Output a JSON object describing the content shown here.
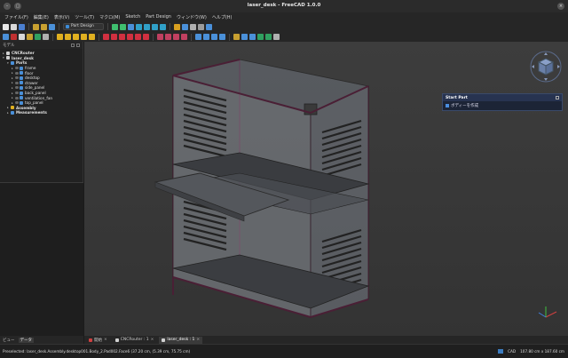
{
  "window": {
    "title": "laser_desk - FreeCAD 1.0.0",
    "minimize_label": "–",
    "maximize_label": "▢",
    "close_label": "×"
  },
  "menu": [
    "ファイル(F)",
    "編集(E)",
    "表示(V)",
    "ツール(T)",
    "マクロ(M)",
    "Sketch",
    "Part Design",
    "ウィンドウ(W)",
    "ヘルプ(H)"
  ],
  "toolbar": {
    "workbench_selector": "Part Design"
  },
  "model_panel": {
    "title": "モデル",
    "tree": [
      {
        "label": "CNCRouter",
        "indent": 0,
        "arrow": "▸",
        "icon": "document-icon",
        "color": "#d0d0d0",
        "bold": true
      },
      {
        "label": "laser_desk",
        "indent": 0,
        "arrow": "▾",
        "icon": "document-icon",
        "color": "#d0d0d0",
        "bold": true
      },
      {
        "label": "Parts",
        "indent": 1,
        "arrow": "▾",
        "icon": "group-folder-icon",
        "color": "#4a90d9",
        "bold": true
      },
      {
        "label": "frame",
        "indent": 2,
        "arrow": "▸",
        "icon": "body-icon",
        "color": "#4a90d9",
        "bold": false
      },
      {
        "label": "floor",
        "indent": 2,
        "arrow": "▸",
        "icon": "body-icon",
        "color": "#4a90d9",
        "bold": false
      },
      {
        "label": "desktop",
        "indent": 2,
        "arrow": "▸",
        "icon": "body-icon",
        "color": "#4a90d9",
        "bold": false
      },
      {
        "label": "drawer",
        "indent": 2,
        "arrow": "▸",
        "icon": "body-icon",
        "color": "#4a90d9",
        "bold": false
      },
      {
        "label": "side_panel",
        "indent": 2,
        "arrow": "▸",
        "icon": "body-icon",
        "color": "#4a90d9",
        "bold": false
      },
      {
        "label": "back_panel",
        "indent": 2,
        "arrow": "▸",
        "icon": "body-icon",
        "color": "#4a90d9",
        "bold": false
      },
      {
        "label": "ventilation_fan",
        "indent": 2,
        "arrow": "▸",
        "icon": "body-icon",
        "color": "#4a90d9",
        "bold": false
      },
      {
        "label": "top_panel",
        "indent": 2,
        "arrow": "▸",
        "icon": "body-icon",
        "color": "#4a90d9",
        "bold": false
      },
      {
        "label": "Assembly",
        "indent": 1,
        "arrow": "▸",
        "icon": "assembly-icon",
        "color": "#e0b020",
        "bold": true
      },
      {
        "label": "Measurements",
        "indent": 1,
        "arrow": "▸",
        "icon": "measurement-group-icon",
        "color": "#4a90d9",
        "bold": true
      }
    ]
  },
  "bottom_left_tabs": {
    "view": "ビュー",
    "data": "データ"
  },
  "task_panel": {
    "title": "Start Part",
    "action": "ボディーを作成"
  },
  "document_tabs": [
    {
      "label": "開始",
      "icon_color": "#d04040",
      "active": false
    },
    {
      "label": "CNCRouter : 1",
      "icon_color": "#d0d0d0",
      "active": false
    },
    {
      "label": "laser_desk : 1",
      "icon_color": "#d0d0d0",
      "active": true
    }
  ],
  "document_tab_close": "×",
  "status_bar": {
    "message": "Preselected: laser_desk.Assembly.desktop001.Body_2.Pad002.Face6 (37.20 cm, (5.39 cm, 75.75 cm)",
    "unit_system": "CAD",
    "dimensions": "107.80 cm x 187.60 cm"
  },
  "colors": {
    "frame_edge": "#4a1f35",
    "panel_fill": "#7a7e86",
    "accent": "#4a90d9"
  }
}
